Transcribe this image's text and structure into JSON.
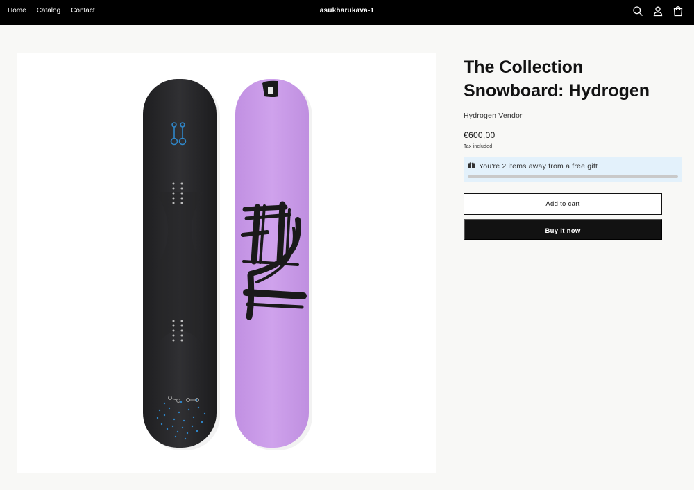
{
  "header": {
    "nav": [
      "Home",
      "Catalog",
      "Contact"
    ],
    "brand": "asukharukava-1",
    "icons": [
      "search-icon",
      "account-icon",
      "cart-icon"
    ]
  },
  "product": {
    "title": "The Collection Snowboard: Hydrogen",
    "vendor": "Hydrogen Vendor",
    "price": "€600,00",
    "tax_note": "Tax included.",
    "image_alt": "Snowboard top and bottom view with H2 graphic"
  },
  "gift_banner": {
    "text": "You're 2 items away from a free gift",
    "progress": 0
  },
  "actions": {
    "add_to_cart": "Add to cart",
    "buy_now": "Buy it now"
  },
  "colors": {
    "header_bg": "#000000",
    "board_dark": "#2b2b2d",
    "board_purple": "#c89be6",
    "gift_banner_bg": "#e3f1fb",
    "accent_blue": "#2f86c8"
  }
}
